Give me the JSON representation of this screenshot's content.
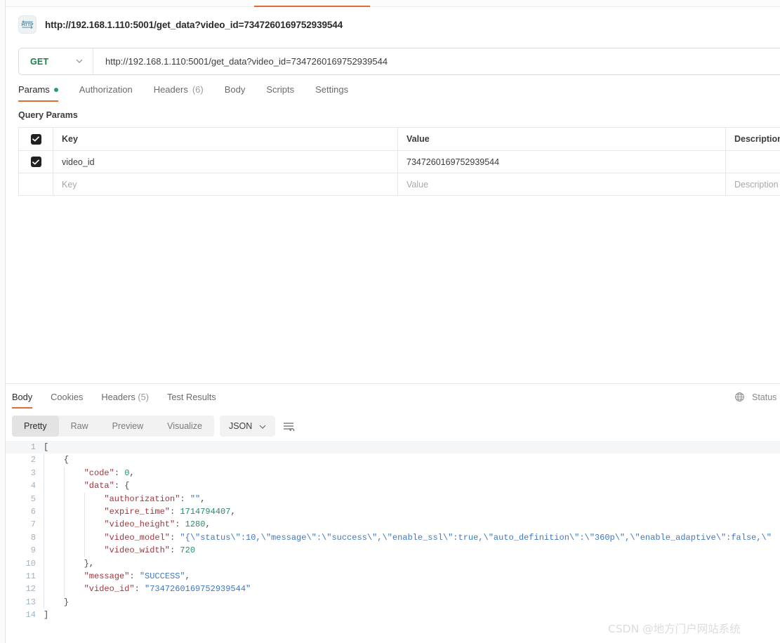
{
  "app": {
    "request_title": "http://192.168.1.110:5001/get_data?video_id=7347260169752939544",
    "http_icon_label": "HTTP",
    "accent_color": "#e06c33",
    "method_color": "#1a7f4b"
  },
  "url_bar": {
    "method": "GET",
    "method_caret": "⌄",
    "url": "http://192.168.1.110:5001/get_data?video_id=7347260169752939544"
  },
  "request_tabs": [
    {
      "label": "Params",
      "indicator": "dot",
      "count": ""
    },
    {
      "label": "Authorization",
      "indicator": "",
      "count": ""
    },
    {
      "label": "Headers",
      "indicator": "",
      "count": "(6)"
    },
    {
      "label": "Body",
      "indicator": "",
      "count": ""
    },
    {
      "label": "Scripts",
      "indicator": "",
      "count": ""
    },
    {
      "label": "Settings",
      "indicator": "",
      "count": ""
    }
  ],
  "query_params": {
    "section_title": "Query Params",
    "headers": {
      "key": "Key",
      "value": "Value",
      "description": "Description"
    },
    "rows": [
      {
        "checked": true,
        "key": "video_id",
        "value": "7347260169752939544",
        "description": ""
      }
    ],
    "placeholder_row": {
      "key": "Key",
      "value": "Value",
      "description": "Description"
    }
  },
  "response_tabs": [
    {
      "label": "Body",
      "count": ""
    },
    {
      "label": "Cookies",
      "count": ""
    },
    {
      "label": "Headers",
      "count": "(5)"
    },
    {
      "label": "Test Results",
      "count": ""
    }
  ],
  "response_status": {
    "globe_icon": "globe-icon",
    "label": "Status"
  },
  "view_toolbar": {
    "segments": [
      "Pretty",
      "Raw",
      "Preview",
      "Visualize"
    ],
    "active_segment": "Pretty",
    "format": "JSON",
    "format_caret": "⌄",
    "wrap_icon": "wrap-lines-icon"
  },
  "response_body": {
    "language": "json",
    "lines": [
      {
        "n": "1",
        "indent": 0,
        "text": "["
      },
      {
        "n": "2",
        "indent": 1,
        "text": "    {"
      },
      {
        "n": "3",
        "indent": 2,
        "text": "        \"code\": 0,"
      },
      {
        "n": "4",
        "indent": 2,
        "text": "        \"data\": {"
      },
      {
        "n": "5",
        "indent": 3,
        "text": "            \"authorization\": \"\","
      },
      {
        "n": "6",
        "indent": 3,
        "text": "            \"expire_time\": 1714794407,"
      },
      {
        "n": "7",
        "indent": 3,
        "text": "            \"video_height\": 1280,"
      },
      {
        "n": "8",
        "indent": 3,
        "text": "            \"video_model\": \"{\\\"status\\\":10,\\\"message\\\":\\\"success\\\",\\\"enable_ssl\\\":true,\\\"auto_definition\\\":\\\"360p\\\",\\\"enable_adaptive\\\":false,\\\""
      },
      {
        "n": "9",
        "indent": 3,
        "text": "            \"video_width\": 720"
      },
      {
        "n": "10",
        "indent": 2,
        "text": "        },"
      },
      {
        "n": "11",
        "indent": 2,
        "text": "        \"message\": \"SUCCESS\","
      },
      {
        "n": "12",
        "indent": 2,
        "text": "        \"video_id\": \"7347260169752939544\""
      },
      {
        "n": "13",
        "indent": 1,
        "text": "    }"
      },
      {
        "n": "14",
        "indent": 0,
        "text": "]"
      }
    ]
  },
  "watermark": {
    "text": "CSDN @地方门户网站系统"
  }
}
